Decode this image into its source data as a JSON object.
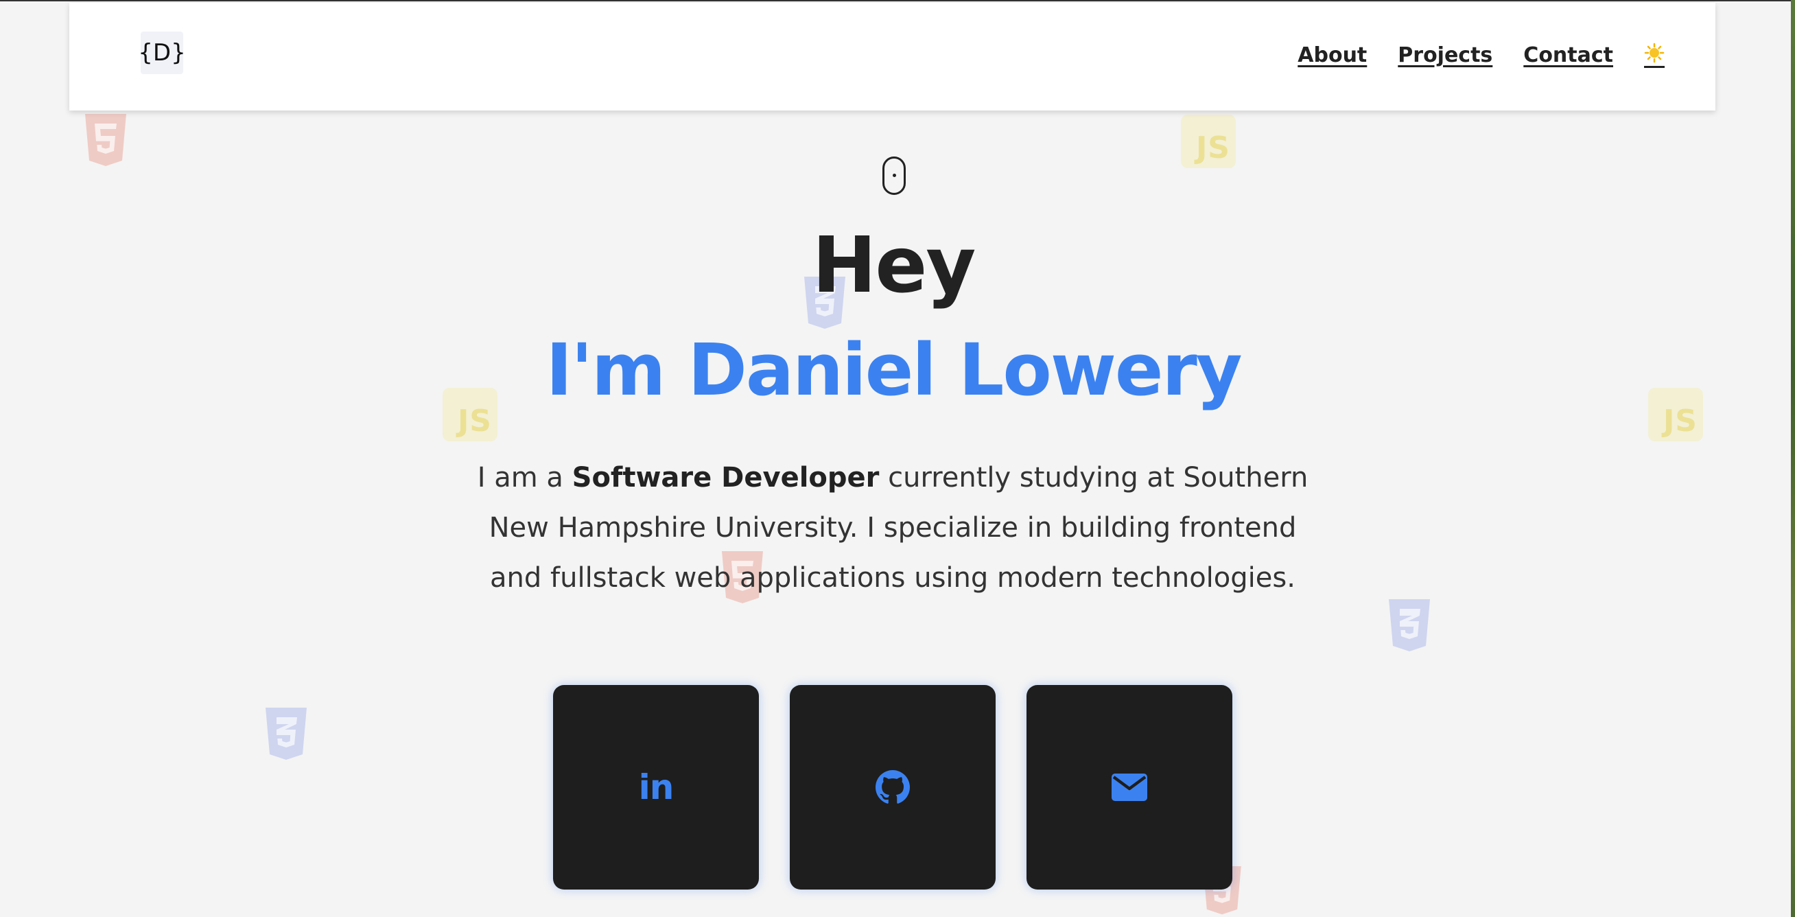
{
  "header": {
    "logo_text": "{D}",
    "nav": [
      {
        "label": "About"
      },
      {
        "label": "Projects"
      },
      {
        "label": "Contact"
      }
    ],
    "theme_toggle_icon": "sun-icon"
  },
  "hero": {
    "greeting": "Hey",
    "name": "I'm Daniel Lowery",
    "bio_prefix": "I am a ",
    "bio_highlight": "Software Developer",
    "bio_suffix": " currently studying at Southern New Hampshire University. I specialize in building frontend and fullstack web applications using modern technologies.",
    "scroll_icon": "mouse-icon"
  },
  "social": [
    {
      "icon": "linkedin-icon",
      "text": "in"
    },
    {
      "icon": "github-icon"
    },
    {
      "icon": "envelope-icon"
    }
  ],
  "decorations": [
    "html5-icon",
    "css3-icon",
    "javascript-icon"
  ],
  "colors": {
    "accent": "#3b82f0",
    "background": "#f4f4f4",
    "card": "#1e1e1e",
    "text": "#222222"
  }
}
